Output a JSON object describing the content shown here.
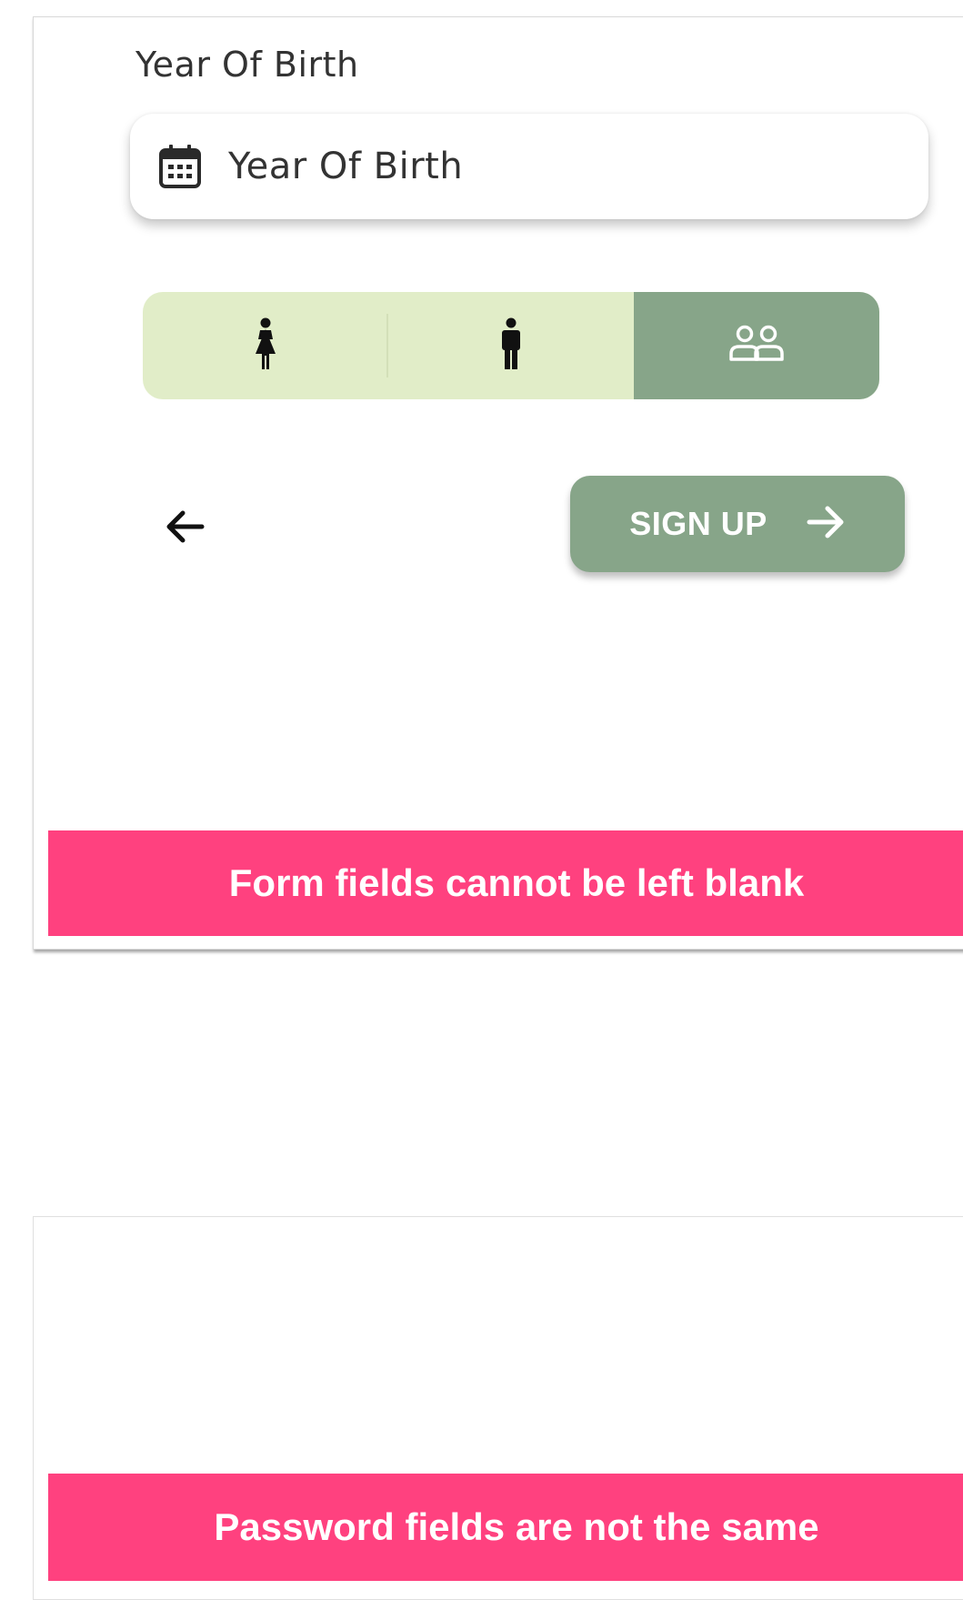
{
  "screen_1": {
    "year_of_birth": {
      "label": "Year Of Birth",
      "placeholder": "Year Of Birth",
      "icon": "calendar-icon"
    },
    "gender_toggle": {
      "options": [
        {
          "icon": "female-icon",
          "selected": false
        },
        {
          "icon": "male-icon",
          "selected": false
        },
        {
          "icon": "people-icon",
          "selected": true
        }
      ],
      "colors": {
        "unselected_bg": "#e1edc8",
        "selected_bg": "#87a589"
      }
    },
    "navigation": {
      "back_icon": "arrow-left-icon",
      "signup_label": "SIGN UP",
      "signup_icon": "arrow-right-icon",
      "signup_color": "#87a589"
    },
    "snackbar": {
      "message": "Form fields cannot be left blank",
      "color": "#ff417f"
    }
  },
  "screen_2": {
    "snackbar": {
      "message": "Password fields are not the same",
      "color": "#ff417f"
    }
  }
}
